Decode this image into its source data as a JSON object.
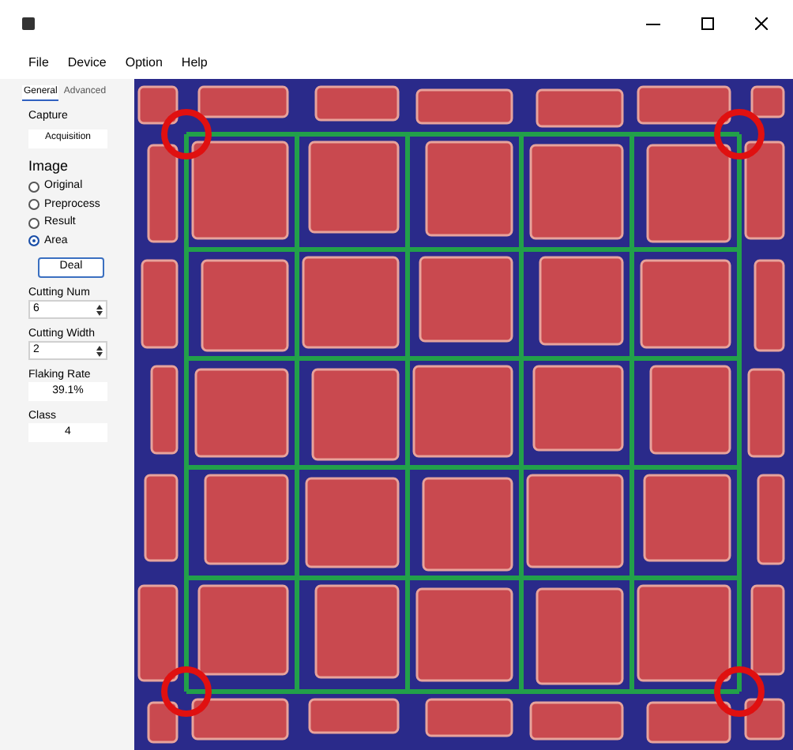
{
  "menu": [
    "File",
    "Device",
    "Option",
    "Help"
  ],
  "tabs": [
    {
      "label": "General",
      "selected": true
    },
    {
      "label": "Advanced",
      "selected": false
    }
  ],
  "capture": {
    "label": "Capture",
    "button": "Acquisition"
  },
  "image": {
    "label": "Image",
    "options": [
      {
        "label": "Original",
        "selected": false
      },
      {
        "label": "Preprocess",
        "selected": false
      },
      {
        "label": "Result",
        "selected": false
      },
      {
        "label": "Area",
        "selected": true
      }
    ]
  },
  "deal_button": "Deal",
  "cutting_num": {
    "label": "Cutting Num",
    "value": "6"
  },
  "cutting_width": {
    "label": "Cutting Width",
    "value": "2"
  },
  "flaking_rate": {
    "label": "Flaking Rate",
    "value": "39.1%"
  },
  "class": {
    "label": "Class",
    "value": "4"
  }
}
